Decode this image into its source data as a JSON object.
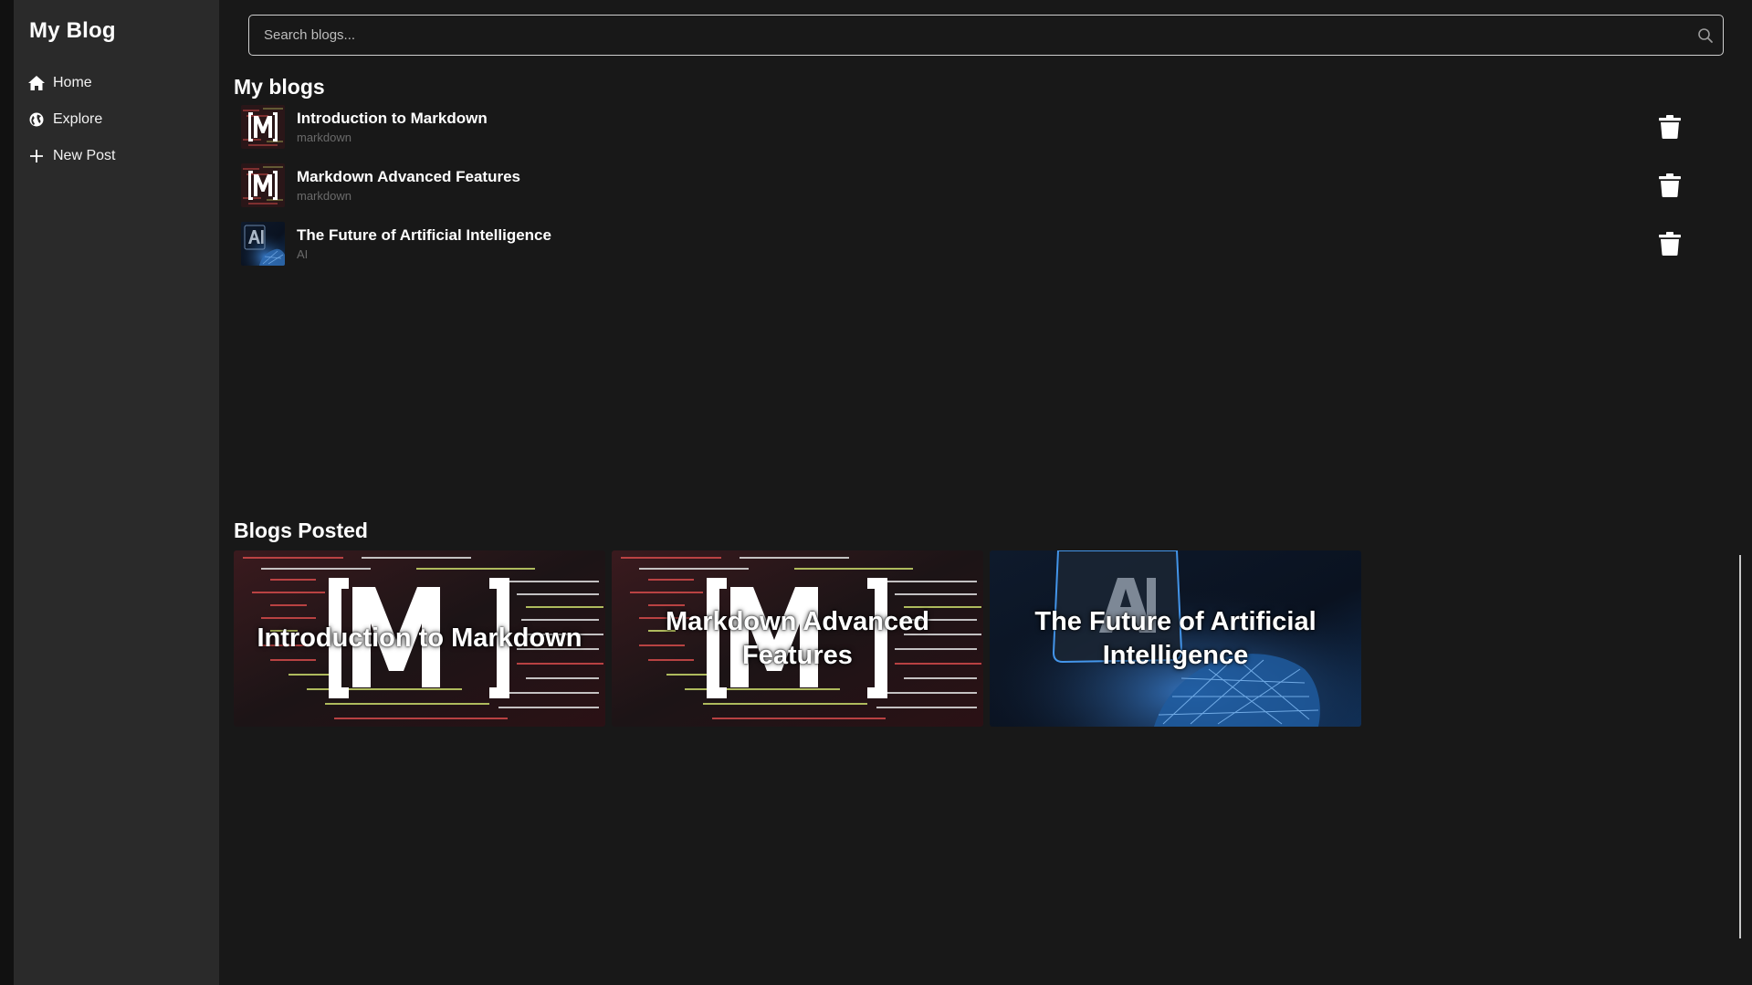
{
  "app": {
    "title": "My Blog"
  },
  "sidebar": {
    "items": [
      {
        "label": "Home",
        "icon": "home-icon"
      },
      {
        "label": "Explore",
        "icon": "globe-icon"
      },
      {
        "label": "New Post",
        "icon": "plus-icon"
      }
    ]
  },
  "search": {
    "placeholder": "Search blogs...",
    "value": ""
  },
  "my_blogs": {
    "title": "My blogs",
    "items": [
      {
        "title": "Introduction to Markdown",
        "tag": "markdown",
        "thumb": "markdown-logo"
      },
      {
        "title": "Markdown Advanced Features",
        "tag": "markdown",
        "thumb": "markdown-logo"
      },
      {
        "title": "The Future of Artificial Intelligence",
        "tag": "AI",
        "thumb": "ai-hand"
      }
    ]
  },
  "blogs_posted": {
    "title": "Blogs Posted",
    "cards": [
      {
        "title": "Introduction to Markdown",
        "image": "markdown-code"
      },
      {
        "title": "Markdown Advanced Features",
        "image": "markdown-code"
      },
      {
        "title": "The Future of Artificial Intelligence",
        "image": "ai-hand"
      }
    ]
  },
  "colors": {
    "background": "#181818",
    "sidebar": "#2a2a2a",
    "text": "#ffffff",
    "muted": "#6a6a6a",
    "search_border": "#cfcfcf"
  }
}
